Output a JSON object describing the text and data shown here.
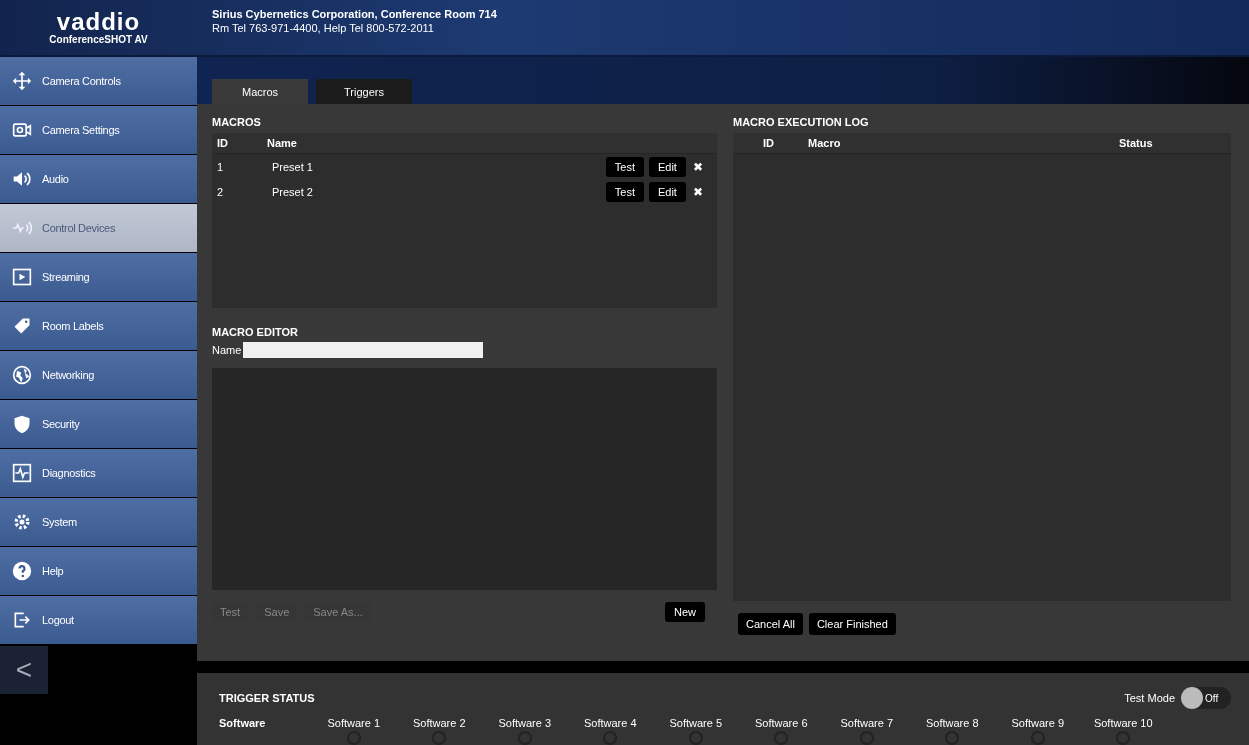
{
  "header": {
    "logo": "vaddio",
    "product": "ConferenceSHOT AV",
    "location": "Sirius Cybernetics Corporation, Conference Room 714",
    "phones": "Rm Tel 763-971-4400, Help Tel 800-572-2011"
  },
  "sidebar": {
    "items": [
      {
        "label": "Camera Controls",
        "selected": false
      },
      {
        "label": "Camera Settings",
        "selected": false
      },
      {
        "label": "Audio",
        "selected": false
      },
      {
        "label": "Control Devices",
        "selected": true
      },
      {
        "label": "Streaming",
        "selected": false
      },
      {
        "label": "Room Labels",
        "selected": false
      },
      {
        "label": "Networking",
        "selected": false
      },
      {
        "label": "Security",
        "selected": false
      },
      {
        "label": "Diagnostics",
        "selected": false
      },
      {
        "label": "System",
        "selected": false
      },
      {
        "label": "Help",
        "selected": false
      },
      {
        "label": "Logout",
        "selected": false
      }
    ],
    "collapse": "<"
  },
  "tabs": [
    {
      "label": "Macros",
      "selected": true
    },
    {
      "label": "Triggers",
      "selected": false
    }
  ],
  "macros": {
    "title": "MACROS",
    "columns": [
      "ID",
      "Name"
    ],
    "rows": [
      {
        "id": "1",
        "name": "Preset 1",
        "test": "Test",
        "edit": "Edit",
        "delete": "✖"
      },
      {
        "id": "2",
        "name": "Preset 2",
        "test": "Test",
        "edit": "Edit",
        "delete": "✖"
      }
    ]
  },
  "macro_editor": {
    "title": "MACRO EDITOR",
    "name_label": "Name",
    "buttons": [
      {
        "label": "Test",
        "disabled": true
      },
      {
        "label": "Save",
        "disabled": true
      },
      {
        "label": "Save As...",
        "disabled": true
      }
    ],
    "new_button": "New"
  },
  "execution_log": {
    "title": "MACRO EXECUTION LOG",
    "columns": [
      "ID",
      "Macro",
      "Status"
    ],
    "buttons": [
      "Cancel All",
      "Clear Finished"
    ]
  },
  "trigger_status": {
    "title": "TRIGGER STATUS",
    "test_mode_label": "Test Mode",
    "test_mode": {
      "on": false,
      "label": "Off"
    },
    "group": "Software",
    "triggers": [
      "Software 1",
      "Software 2",
      "Software 3",
      "Software 4",
      "Software 5",
      "Software 6",
      "Software 7",
      "Software 8",
      "Software 9",
      "Software 10"
    ]
  }
}
